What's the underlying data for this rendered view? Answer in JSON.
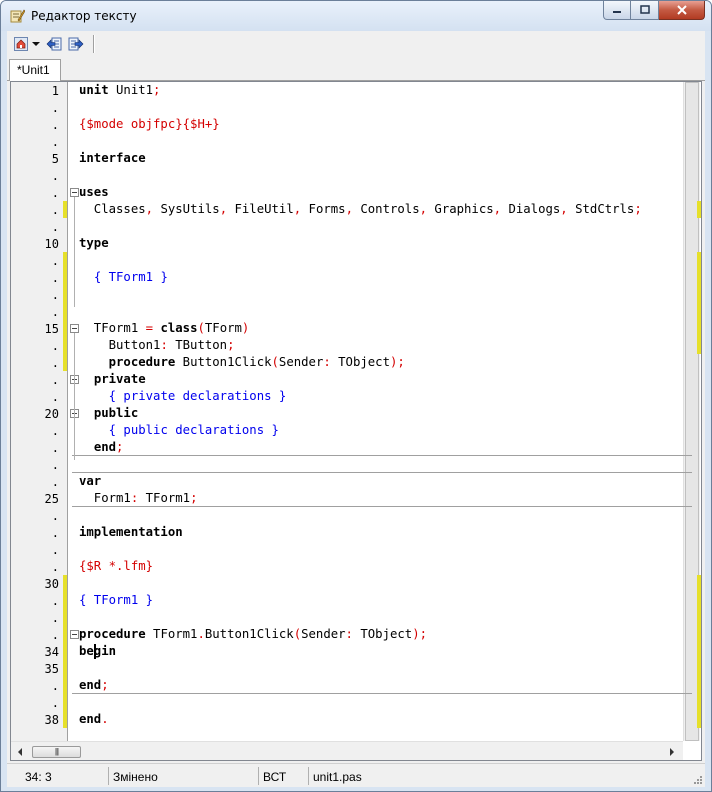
{
  "window": {
    "title": "Редактор тексту"
  },
  "toolbar": {
    "icons": [
      "home-icon",
      "dropdown-arrow-icon",
      "jump-back-icon",
      "jump-forward-icon"
    ]
  },
  "tabs": [
    {
      "label": "*Unit1"
    }
  ],
  "editor": {
    "gutter_labels": [
      "1",
      ".",
      ".",
      ".",
      "5",
      ".",
      ".",
      ".",
      ".",
      "10",
      ".",
      ".",
      ".",
      ".",
      "15",
      ".",
      ".",
      ".",
      ".",
      "20",
      ".",
      ".",
      ".",
      ".",
      "25",
      ".",
      ".",
      ".",
      ".",
      "30",
      ".",
      ".",
      ".",
      "34",
      "35",
      ".",
      ".",
      "38"
    ],
    "lines": [
      [
        {
          "t": "unit",
          "c": "kw"
        },
        {
          "t": " Unit1"
        },
        {
          "t": ";",
          "c": "sym"
        }
      ],
      [],
      [
        {
          "t": "{$mode objfpc}{$H+}",
          "c": "dir"
        }
      ],
      [],
      [
        {
          "t": "interface",
          "c": "kw"
        }
      ],
      [],
      [
        {
          "t": "uses",
          "c": "kw"
        }
      ],
      [
        {
          "t": "  Classes"
        },
        {
          "t": ",",
          "c": "sym"
        },
        {
          "t": " SysUtils"
        },
        {
          "t": ",",
          "c": "sym"
        },
        {
          "t": " FileUtil"
        },
        {
          "t": ",",
          "c": "sym"
        },
        {
          "t": " Forms"
        },
        {
          "t": ",",
          "c": "sym"
        },
        {
          "t": " Controls"
        },
        {
          "t": ",",
          "c": "sym"
        },
        {
          "t": " Graphics"
        },
        {
          "t": ",",
          "c": "sym"
        },
        {
          "t": " Dialogs"
        },
        {
          "t": ",",
          "c": "sym"
        },
        {
          "t": " StdCtrls"
        },
        {
          "t": ";",
          "c": "sym"
        }
      ],
      [],
      [
        {
          "t": "type",
          "c": "kw"
        }
      ],
      [],
      [
        {
          "t": "  "
        },
        {
          "t": "{ TForm1 }",
          "c": "com"
        }
      ],
      [],
      [],
      [
        {
          "t": "  TForm1 "
        },
        {
          "t": "=",
          "c": "sym"
        },
        {
          "t": " "
        },
        {
          "t": "class",
          "c": "kw"
        },
        {
          "t": "(",
          "c": "sym"
        },
        {
          "t": "TForm"
        },
        {
          "t": ")",
          "c": "sym"
        }
      ],
      [
        {
          "t": "    Button1"
        },
        {
          "t": ":",
          "c": "sym"
        },
        {
          "t": " TButton"
        },
        {
          "t": ";",
          "c": "sym"
        }
      ],
      [
        {
          "t": "    "
        },
        {
          "t": "procedure",
          "c": "kw"
        },
        {
          "t": " Button1Click"
        },
        {
          "t": "(",
          "c": "sym"
        },
        {
          "t": "Sender"
        },
        {
          "t": ":",
          "c": "sym"
        },
        {
          "t": " TObject"
        },
        {
          "t": ");",
          "c": "sym"
        }
      ],
      [
        {
          "t": "  "
        },
        {
          "t": "private",
          "c": "kw"
        }
      ],
      [
        {
          "t": "    "
        },
        {
          "t": "{ private declarations }",
          "c": "com"
        }
      ],
      [
        {
          "t": "  "
        },
        {
          "t": "public",
          "c": "kw"
        }
      ],
      [
        {
          "t": "    "
        },
        {
          "t": "{ public declarations }",
          "c": "com"
        }
      ],
      [
        {
          "t": "  "
        },
        {
          "t": "end",
          "c": "kw"
        },
        {
          "t": ";",
          "c": "sym"
        }
      ],
      [],
      [
        {
          "t": "var",
          "c": "kw"
        }
      ],
      [
        {
          "t": "  Form1"
        },
        {
          "t": ":",
          "c": "sym"
        },
        {
          "t": " TForm1"
        },
        {
          "t": ";",
          "c": "sym"
        }
      ],
      [],
      [
        {
          "t": "implementation",
          "c": "kw"
        }
      ],
      [],
      [
        {
          "t": "{$R *.lfm}",
          "c": "dir"
        }
      ],
      [],
      [
        {
          "t": "{ TForm1 }",
          "c": "com"
        }
      ],
      [],
      [
        {
          "t": "procedure",
          "c": "kw"
        },
        {
          "t": " TForm1"
        },
        {
          "t": ".",
          "c": "sym"
        },
        {
          "t": "Button1Click"
        },
        {
          "t": "(",
          "c": "sym"
        },
        {
          "t": "Sender"
        },
        {
          "t": ":",
          "c": "sym"
        },
        {
          "t": " TObject"
        },
        {
          "t": ");",
          "c": "sym"
        }
      ],
      [
        {
          "t": "begin",
          "c": "kw"
        }
      ],
      [],
      [
        {
          "t": "end",
          "c": "kw"
        },
        {
          "t": ";",
          "c": "sym"
        }
      ],
      [],
      [
        {
          "t": "end",
          "c": "kw"
        },
        {
          "t": ".",
          "c": "sym"
        }
      ]
    ]
  },
  "colors": {
    "keyword": "#000000",
    "directive": "#d40000",
    "comment": "#0000ee",
    "symbol": "#d40000",
    "changed_line_marker": "#e6e02a"
  },
  "statusbar": {
    "position": "34:  3",
    "state": "Змінено",
    "mode": "ВСТ",
    "file": "unit1.pas"
  }
}
